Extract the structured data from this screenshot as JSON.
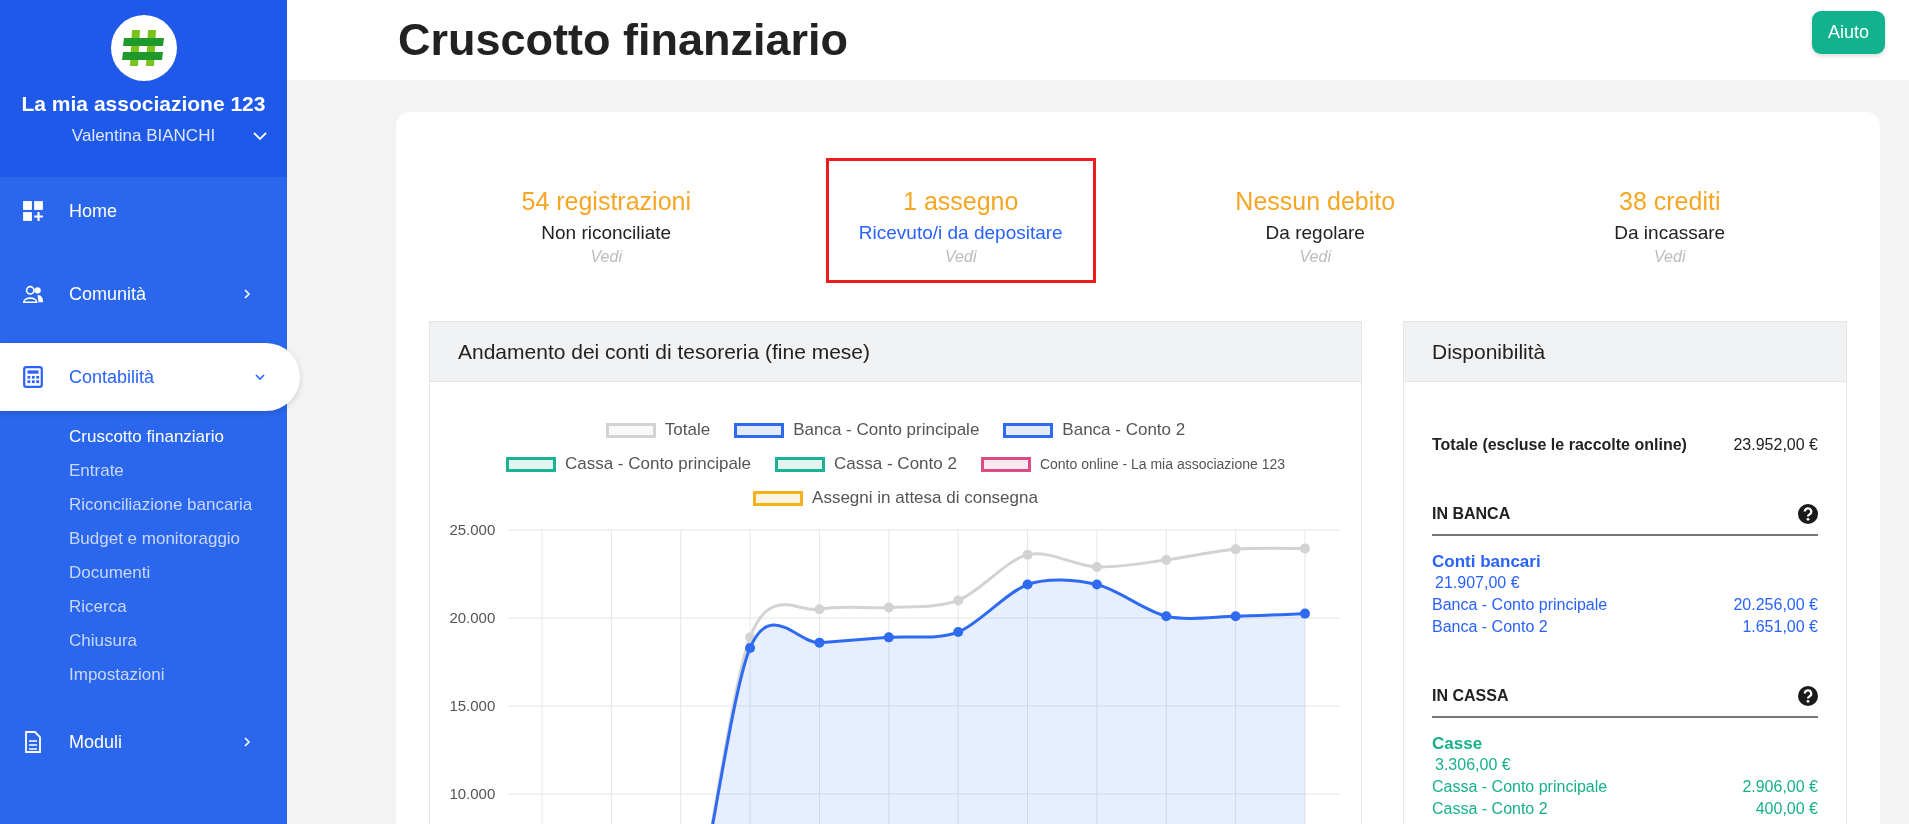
{
  "sidebar": {
    "org_name": "La mia associazione 123",
    "user_name": "Valentina BIANCHI",
    "menu": [
      {
        "label": "Home",
        "kind": "link",
        "selected": false
      },
      {
        "label": "Comunità",
        "kind": "group",
        "expanded": false,
        "selected": false
      },
      {
        "label": "Contabilità",
        "kind": "group",
        "expanded": true,
        "selected": true,
        "children": [
          {
            "label": "Cruscotto finanziario",
            "selected": true
          },
          {
            "label": "Entrate",
            "selected": false
          },
          {
            "label": "Riconciliazione bancaria",
            "selected": false
          },
          {
            "label": "Budget e monitoraggio",
            "selected": false
          },
          {
            "label": "Documenti",
            "selected": false
          },
          {
            "label": "Ricerca",
            "selected": false
          },
          {
            "label": "Chiusura",
            "selected": false
          },
          {
            "label": "Impostazioni",
            "selected": false
          }
        ]
      },
      {
        "label": "Moduli",
        "kind": "group",
        "expanded": false,
        "selected": false
      }
    ]
  },
  "header": {
    "title": "Cruscotto finanziario",
    "help_button": "Aiuto"
  },
  "stats": [
    {
      "value": "54 registrazioni",
      "label": "Non riconciliate",
      "label_is_link": false,
      "link": "Vedi",
      "highlighted": false
    },
    {
      "value": "1 assegno",
      "label": "Ricevuto/i da depositare",
      "label_is_link": true,
      "link": "Vedi",
      "highlighted": true
    },
    {
      "value": "Nessun debito",
      "label": "Da regolare",
      "label_is_link": false,
      "link": "Vedi",
      "highlighted": false
    },
    {
      "value": "38 crediti",
      "label": "Da incassare",
      "label_is_link": false,
      "link": "Vedi",
      "highlighted": false
    }
  ],
  "treasury_chart": {
    "title": "Andamento dei conti di tesoreria (fine mese)",
    "chart_data": {
      "type": "line",
      "grid": true,
      "categories": [
        null,
        null,
        null,
        null,
        null,
        null,
        null,
        null,
        null,
        null,
        null,
        null
      ],
      "ylim": [
        0,
        25000
      ],
      "yticks": [
        {
          "value": 10000,
          "label": "10.000"
        },
        {
          "value": 15000,
          "label": "15.000"
        },
        {
          "value": 20000,
          "label": "20.000"
        },
        {
          "value": 25000,
          "label": "25.000"
        }
      ],
      "series": [
        {
          "name": "Totale",
          "color": "#d3d3d3",
          "marker": "o",
          "values": [
            0,
            0,
            0,
            18900,
            20500,
            20600,
            21000,
            23600,
            22900,
            23300,
            23900,
            23950
          ]
        },
        {
          "name": "Banca - Conto principale",
          "color": "#2f6bf0",
          "type": "area",
          "marker": "o",
          "values": [
            0,
            0,
            0,
            18300,
            18600,
            18900,
            19200,
            21900,
            21900,
            20100,
            20100,
            20250
          ]
        },
        {
          "name": "Banca - Conto 2",
          "color": "#2f6bf0",
          "values": [
            null,
            null,
            null,
            null,
            null,
            null,
            null,
            null,
            null,
            null,
            null,
            null
          ]
        },
        {
          "name": "Cassa - Conto principale",
          "color": "#1bb394",
          "values": [
            null,
            null,
            null,
            null,
            null,
            null,
            null,
            null,
            null,
            null,
            null,
            null
          ]
        },
        {
          "name": "Cassa - Conto 2",
          "color": "#1bb394",
          "values": [
            null,
            null,
            null,
            null,
            null,
            null,
            null,
            null,
            null,
            null,
            null,
            null
          ]
        },
        {
          "name": "Conto online - La mia associazione 123",
          "color": "#d94d86",
          "values": [
            null,
            null,
            null,
            null,
            null,
            null,
            null,
            null,
            null,
            null,
            null,
            null
          ]
        },
        {
          "name": "Assegni in attesa di consegna",
          "color": "#f7b21b",
          "values": [
            null,
            null,
            null,
            null,
            null,
            null,
            null,
            null,
            null,
            null,
            null,
            null
          ]
        }
      ]
    }
  },
  "availability": {
    "title": "Disponibilità",
    "total_label": "Totale (escluse le raccolte online)",
    "total_value": "23.952,00 €",
    "sections": [
      {
        "heading": "IN BANCA",
        "group": "Conti bancari",
        "group_total": "21.907,00 €",
        "color": "#2962ff",
        "accounts": [
          {
            "name": "Banca - Conto principale",
            "amount": "20.256,00 €"
          },
          {
            "name": "Banca - Conto 2",
            "amount": "1.651,00 €"
          }
        ]
      },
      {
        "heading": "IN CASSA",
        "group": "Casse",
        "group_total": "3.306,00 €",
        "color": "#16b08c",
        "accounts": [
          {
            "name": "Cassa - Conto principale",
            "amount": "2.906,00 €"
          },
          {
            "name": "Cassa - Conto 2",
            "amount": "400,00 €"
          }
        ]
      }
    ]
  }
}
